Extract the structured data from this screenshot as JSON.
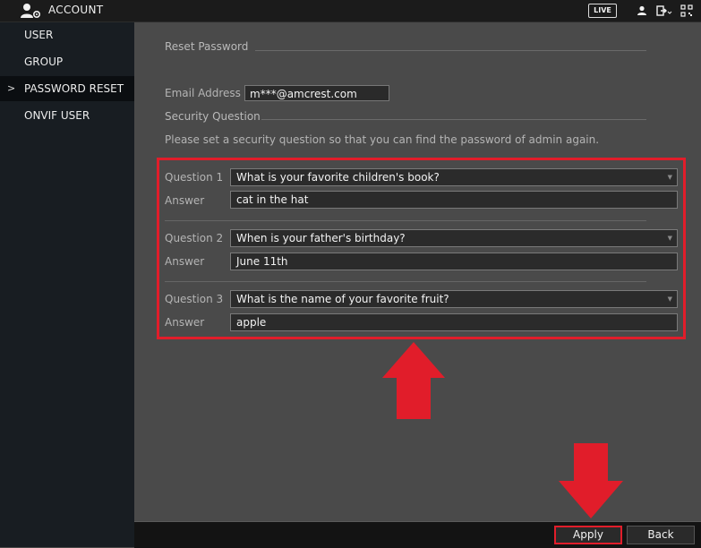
{
  "header": {
    "title": "ACCOUNT",
    "live_label": "LIVE"
  },
  "sidebar": {
    "items": [
      {
        "label": "USER"
      },
      {
        "label": "GROUP"
      },
      {
        "label": "PASSWORD RESET",
        "active": true
      },
      {
        "label": "ONVIF USER"
      }
    ]
  },
  "main": {
    "reset_section_title": "Reset Password",
    "email_label": "Email Address",
    "email_value": "m***@amcrest.com",
    "security_section_title": "Security Question",
    "info_text": "Please set a security question so that you can find the password of admin again.",
    "questions": [
      {
        "label": "Question 1",
        "value": "What is your favorite children's book?",
        "answer_label": "Answer",
        "answer": "cat in the hat"
      },
      {
        "label": "Question 2",
        "value": "When is your father's birthday?",
        "answer_label": "Answer",
        "answer": "June 11th"
      },
      {
        "label": "Question 3",
        "value": "What is the name of your favorite fruit?",
        "answer_label": "Answer",
        "answer": "apple"
      }
    ]
  },
  "footer": {
    "apply_label": "Apply",
    "back_label": "Back"
  },
  "colors": {
    "highlight_red": "#e11d2a",
    "sidebar_bg": "#181d22",
    "main_bg": "#4a4a4a"
  },
  "icons": [
    "account-settings-icon",
    "user-icon",
    "logout-icon",
    "qr-code-icon",
    "chevron-right-icon",
    "dropdown-caret-icon",
    "up-arrow-annotation",
    "down-arrow-annotation"
  ]
}
